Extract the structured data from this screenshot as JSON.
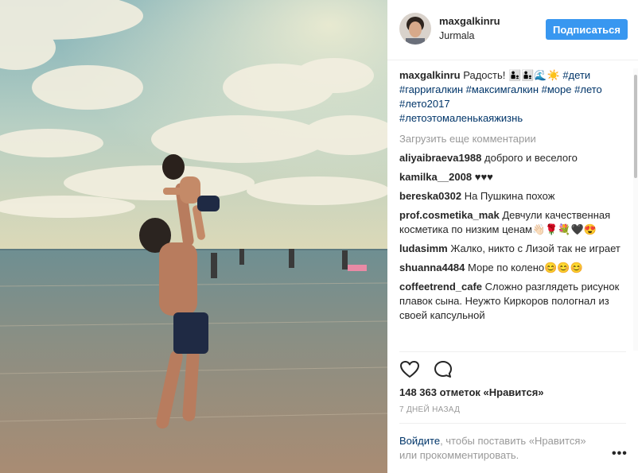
{
  "header": {
    "username": "maxgalkinru",
    "location": "Jurmala",
    "follow_label": "Подписаться"
  },
  "caption": {
    "username": "maxgalkinru",
    "text": "Радость! 👨‍👦👨‍👦🌊☀️",
    "hashtags": [
      "#дети",
      "#гарригалкин",
      "#максимгалкин",
      "#море",
      "#лето",
      "#лето2017",
      "#летоэтомаленькаяжизнь"
    ]
  },
  "load_more": "Загрузить еще комментарии",
  "comments": [
    {
      "user": "aliyaibraeva1988",
      "text": "доброго и веселого"
    },
    {
      "user": "kamilka__2008",
      "text": "♥♥♥"
    },
    {
      "user": "bereska0302",
      "text": "На Пушкина похож"
    },
    {
      "user": "prof.cosmetika_mak",
      "text": "Девчули качественная косметика по низким ценам👋🏻🌹💐🖤😍"
    },
    {
      "user": "ludasimm",
      "text": "Жалко, никто с Лизой так не играет"
    },
    {
      "user": "shuanna4484",
      "text": "Море по колено😊😊😊"
    },
    {
      "user": "coffeetrend_cafe",
      "text": "Сложно разглядеть рисунок плавок сына. Неужто Киркоров пологнал из своей капсульной"
    }
  ],
  "icons": {
    "like": "heart-icon",
    "comment": "comment-bubble-icon",
    "more": "more-options-icon"
  },
  "likes_text": "148 363 отметок «Нравится»",
  "time_text": "7 ДНЕЙ НАЗАД",
  "login": {
    "link": "Войдите",
    "rest": ", чтобы поставить «Нравится» или прокомментировать."
  },
  "more_label": "•••",
  "colors": {
    "accent": "#3897f0",
    "link": "#003569",
    "muted": "#999999"
  }
}
